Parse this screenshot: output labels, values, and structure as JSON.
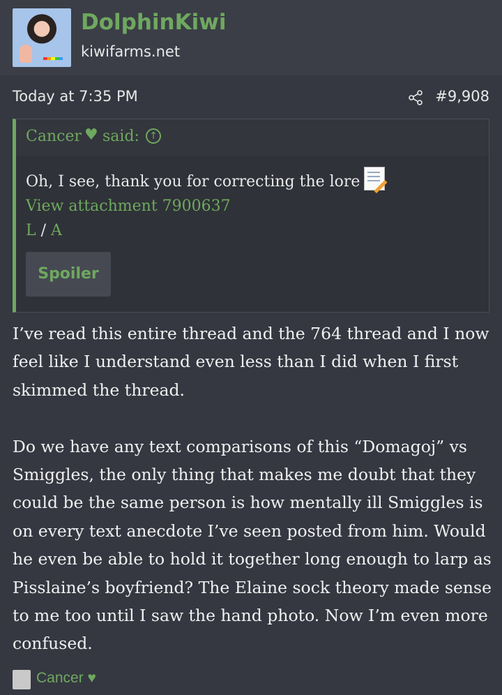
{
  "header": {
    "username": "DolphinKiwi",
    "site": "kiwifarms.net"
  },
  "meta": {
    "timestamp": "Today at 7:35 PM",
    "post_number": "#9,908",
    "share_icon": "share-icon"
  },
  "quote": {
    "author": "Cancer",
    "heart": "♥",
    "said": "said:",
    "jump_icon": "arrow-up-circle-icon",
    "line1": "Oh, I see, thank you for correcting the lore",
    "attachment_link": "View attachment 7900637",
    "link_l": "L",
    "slash": "/",
    "link_a": "A",
    "spoiler_label": "Spoiler"
  },
  "post": {
    "paragraph1": "I’ve read this entire thread and the 764 thread and I now feel like I understand even less than I did when I first skimmed the thread.",
    "paragraph2": "Do we have any text comparisons of this “Domagoj” vs Smiggles, the only thing that makes me doubt that they could be the same person is how mentally ill Smiggles is on every text anecdote I’ve seen posted from him. Would he even be able to hold it together long enough to larp as Pisslaine’s boyfriend? The Elaine sock theory made sense to me too until I saw the hand photo. Now I’m even more confused."
  },
  "reactions": {
    "label": "Cancer ♥"
  },
  "colors": {
    "accent": "#6fa85f",
    "background": "#353841",
    "header_bg": "#3b3e47"
  }
}
